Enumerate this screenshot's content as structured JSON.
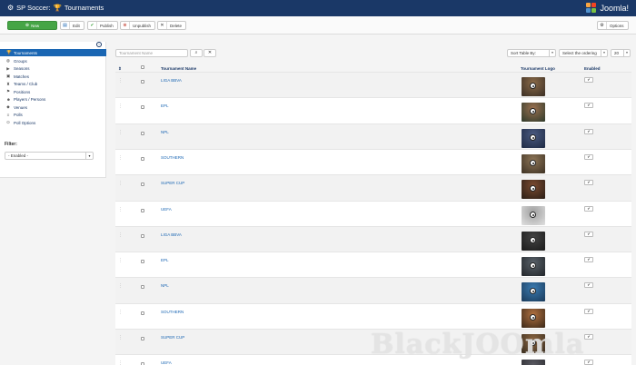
{
  "header": {
    "title": "SP Soccer:",
    "section": "Tournaments",
    "brand": "Joomla!",
    "colors": {
      "bar": "#1a3867",
      "accent": "#1a66b3"
    }
  },
  "toolbar": {
    "new_label": "New",
    "edit_label": "Edit",
    "publish_label": "Publish",
    "unpublish_label": "Unpublish",
    "delete_label": "Delete",
    "options_label": "Options"
  },
  "sidebar": {
    "items": [
      {
        "label": "Tournaments",
        "icon": "trophy-icon",
        "glyph": "🏆"
      },
      {
        "label": "Groups",
        "icon": "groups-icon",
        "glyph": "◍"
      },
      {
        "label": "Seasons",
        "icon": "play-icon",
        "glyph": "▶"
      },
      {
        "label": "Matches",
        "icon": "matches-icon",
        "glyph": "▣"
      },
      {
        "label": "Teams / Club",
        "icon": "shirt-icon",
        "glyph": "♜"
      },
      {
        "label": "Positions",
        "icon": "pin-icon",
        "glyph": "⚑"
      },
      {
        "label": "Players / Persons",
        "icon": "user-icon",
        "glyph": "☻"
      },
      {
        "label": "Venues",
        "icon": "venue-icon",
        "glyph": "◆"
      },
      {
        "label": "Polls",
        "icon": "list-icon",
        "glyph": "≡"
      },
      {
        "label": "Poll Options",
        "icon": "options-icon",
        "glyph": "⊙"
      }
    ],
    "filter_label": "Filter:",
    "filter_value": "- Enabled -"
  },
  "search": {
    "placeholder": "Tournament Name",
    "search_glyph": "⌕",
    "clear_glyph": "✕"
  },
  "sorting": {
    "sort_table": "Sort Table By:",
    "ordering": "Select the ordering",
    "limit": "20"
  },
  "table": {
    "headers": {
      "drag": "⇕",
      "name": "Tournament Name",
      "logo": "Tournament Logo",
      "enabled": "Enabled"
    },
    "rows": [
      {
        "name": "LIGA BBVA",
        "logo_bg": "#3a2e24",
        "logo_hi": "#8a6a48"
      },
      {
        "name": "EPL",
        "logo_bg": "#2e3a2a",
        "logo_hi": "#9a7050"
      },
      {
        "name": "NPL",
        "logo_bg": "#1e2a44",
        "logo_hi": "#4a5a80"
      },
      {
        "name": "SOUTHERN",
        "logo_bg": "#3e3224",
        "logo_hi": "#8c7456"
      },
      {
        "name": "SUPER CUP",
        "logo_bg": "#2a1e16",
        "logo_hi": "#7a4a30"
      },
      {
        "name": "UEFA",
        "logo_bg": "#e0e0e0",
        "logo_hi": "#a0a0a0"
      },
      {
        "name": "LIGA BBVA",
        "logo_bg": "#1a1a1a",
        "logo_hi": "#444444"
      },
      {
        "name": "EPL",
        "logo_bg": "#22262a",
        "logo_hi": "#586068"
      },
      {
        "name": "NPL",
        "logo_bg": "#1a3a5a",
        "logo_hi": "#3a7ab0"
      },
      {
        "name": "SOUTHERN",
        "logo_bg": "#3a2818",
        "logo_hi": "#b07040"
      },
      {
        "name": "SUPER CUP",
        "logo_bg": "#3a2e20",
        "logo_hi": "#8a6440"
      },
      {
        "name": "UEFA",
        "logo_bg": "#2a2a2e",
        "logo_hi": "#5a5a62"
      }
    ],
    "enabled_glyph": "✔"
  },
  "watermark": "BlackJOOmla"
}
